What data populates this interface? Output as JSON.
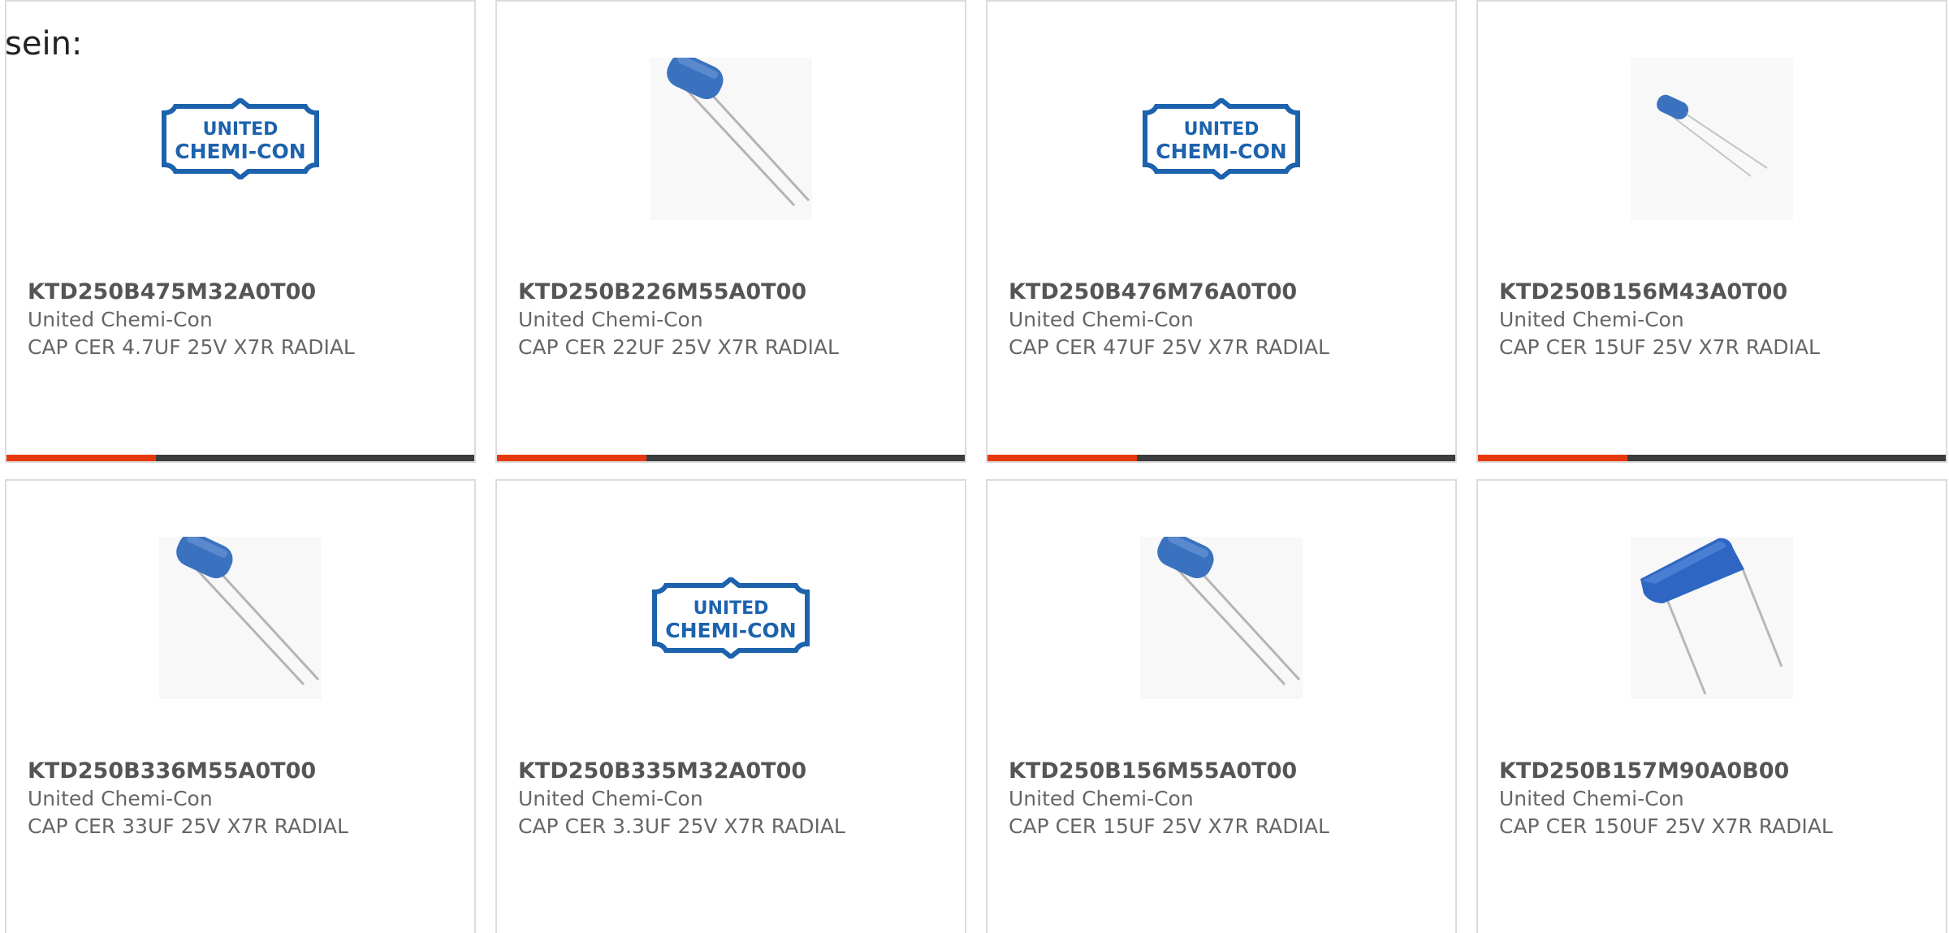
{
  "intro_text": "sein:",
  "colors": {
    "accent": "#e8380d",
    "bar": "#3c3c3c",
    "capacitor_blue": "#3a72c0",
    "logo_blue": "#1c62ad"
  },
  "logo_text": {
    "line1": "UNITED",
    "line2": "CHEMI-CON"
  },
  "products": [
    {
      "part_number": "KTD250B475M32A0T00",
      "manufacturer": "United Chemi-Con",
      "description": "CAP CER 4.7UF 25V X7R RADIAL",
      "image": "manufacturer-logo"
    },
    {
      "part_number": "KTD250B226M55A0T00",
      "manufacturer": "United Chemi-Con",
      "description": "CAP CER 22UF 25V X7R RADIAL",
      "image": "radial-capacitor"
    },
    {
      "part_number": "KTD250B476M76A0T00",
      "manufacturer": "United Chemi-Con",
      "description": "CAP CER 47UF 25V X7R RADIAL",
      "image": "manufacturer-logo"
    },
    {
      "part_number": "KTD250B156M43A0T00",
      "manufacturer": "United Chemi-Con",
      "description": "CAP CER 15UF 25V X7R RADIAL",
      "image": "small-radial-capacitor"
    },
    {
      "part_number": "KTD250B336M55A0T00",
      "manufacturer": "United Chemi-Con",
      "description": "CAP CER 33UF 25V X7R RADIAL",
      "image": "radial-capacitor"
    },
    {
      "part_number": "KTD250B335M32A0T00",
      "manufacturer": "United Chemi-Con",
      "description": "CAP CER 3.3UF 25V X7R RADIAL",
      "image": "manufacturer-logo"
    },
    {
      "part_number": "KTD250B156M55A0T00",
      "manufacturer": "United Chemi-Con",
      "description": "CAP CER 15UF 25V X7R RADIAL",
      "image": "radial-capacitor"
    },
    {
      "part_number": "KTD250B157M90A0B00",
      "manufacturer": "United Chemi-Con",
      "description": "CAP CER 150UF 25V X7R RADIAL",
      "image": "large-radial-capacitor"
    }
  ]
}
